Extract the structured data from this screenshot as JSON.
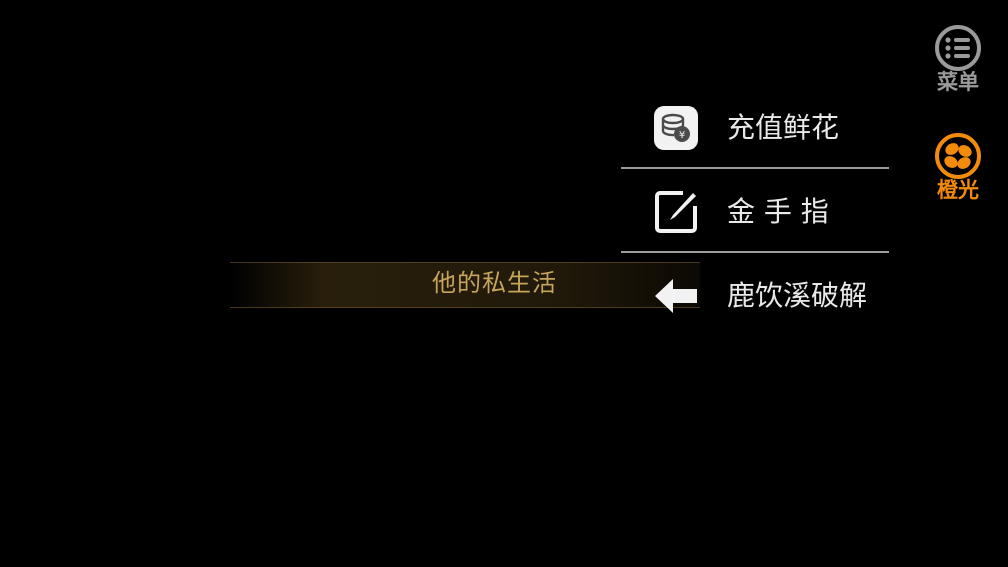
{
  "story": {
    "chapter_title": "他的私生活"
  },
  "menu": {
    "items": [
      {
        "label": "充值鲜花",
        "icon": "coin-stack-icon"
      },
      {
        "label": "金 手 指",
        "icon": "edit-note-icon"
      },
      {
        "label": "鹿饮溪破解",
        "icon": "arrow-left-icon"
      }
    ]
  },
  "side_buttons": {
    "menu": {
      "label": "菜单",
      "icon": "menu-list-icon"
    },
    "brand": {
      "label": "橙光",
      "icon": "orange-light-logo-icon"
    }
  },
  "colors": {
    "background": "#000000",
    "menu_text": "#e9e9e9",
    "chapter_gold": "#c7a45c",
    "brand_orange": "#f28a0c",
    "side_gray": "#9a9a9a"
  }
}
